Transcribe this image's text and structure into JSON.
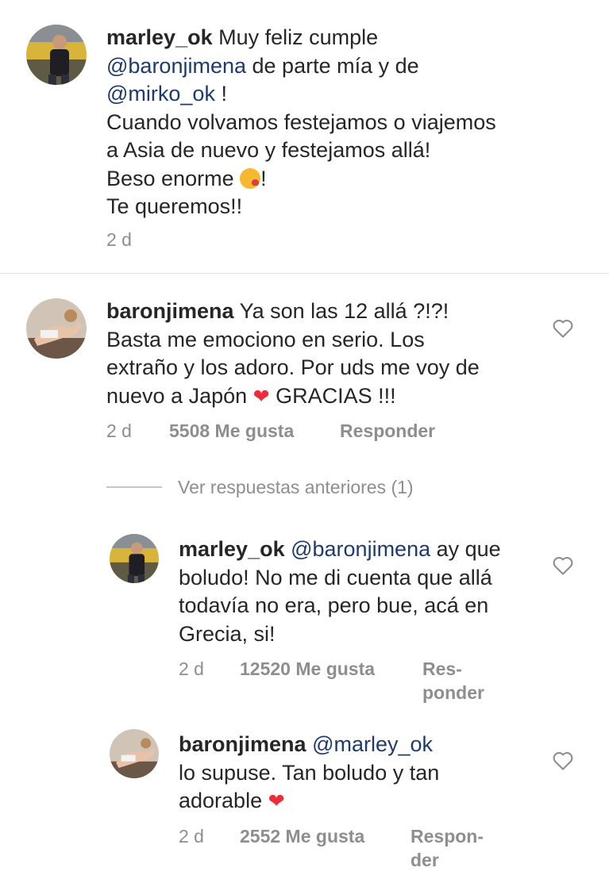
{
  "comments": [
    {
      "username": "marley_ok",
      "line1": "Muy feliz cumple",
      "mention1": "@baronjimena",
      "after_mention1": " de parte mía y de",
      "mention2": "@mirko_ok",
      "after_mention2": " !",
      "line4": "Cuando volvamos festejamos o viajemos",
      "line5": "a Asia de nuevo y festejamos allá!",
      "line6_pre": "Beso enorme ",
      "line6_post": "!",
      "line7": "Te queremos!!",
      "time": "2 d"
    },
    {
      "username": "baronjimena",
      "line1": "Ya son las 12 allá ?!?!",
      "line2": "Basta me emociono en serio. Los",
      "line3": "extraño y los adoro. Por uds me voy de",
      "line4_pre": "nuevo a Japón ",
      "line4_post": " GRACIAS !!!",
      "time": "2 d",
      "likes": "5508 Me gusta",
      "reply": "Responder"
    }
  ],
  "view_previous": "Ver respuestas anteriores (1)",
  "replies": [
    {
      "username": "marley_ok",
      "mention": "@baronjimena",
      "line1_post": " ay que",
      "line2": "boludo! No me di cuenta que allá",
      "line3": "todavía no era, pero bue, acá en",
      "line4": "Grecia, si!",
      "time": "2 d",
      "likes": "12520 Me gusta",
      "reply1": "Res-",
      "reply2": "ponder"
    },
    {
      "username": "baronjimena",
      "mention": "@marley_ok",
      "line2": "lo supuse. Tan boludo y tan",
      "line3_pre": "adorable ",
      "time": "2 d",
      "likes": "2552 Me gusta",
      "reply1": "Respon-",
      "reply2": "der"
    }
  ],
  "icons": {
    "heart": "heart-emoji",
    "like": "heart-outline-icon",
    "kiss": "face-blowing-kiss-emoji"
  },
  "colors": {
    "mention": "#1f3b6e",
    "meta": "#8e8e8e",
    "heart": "#ed2b3a"
  }
}
